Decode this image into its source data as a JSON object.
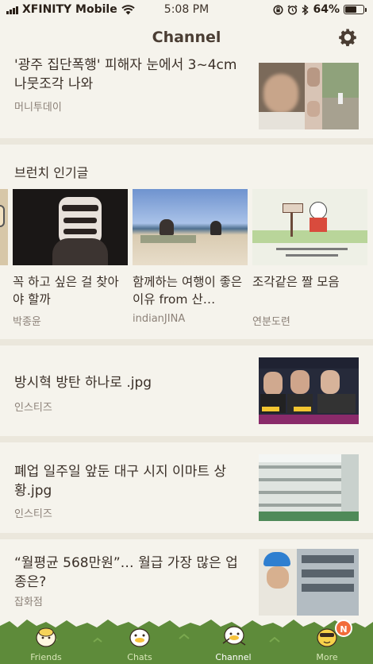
{
  "status": {
    "carrier": "XFINITY Mobile",
    "time": "5:08 PM",
    "battery_percent": "64%",
    "battery_level": 0.64
  },
  "nav": {
    "title": "Channel"
  },
  "articles_top": [
    {
      "headline": "'광주 집단폭행' 피해자 눈에서 3~4cm 나뭇조각 나와",
      "source": "머니투데이"
    }
  ],
  "brunch": {
    "section_title": "브런치 인기글",
    "cards": [
      {
        "title": "꼭 하고 싶은 걸 찾아야 할까",
        "author": "박종윤"
      },
      {
        "title": "함께하는 여행이 좋은 이유 from 산…",
        "author": "indianJINA"
      },
      {
        "title": "조각같은 짤 모음",
        "author": "연분도련"
      }
    ]
  },
  "articles": [
    {
      "headline": "방시혁 방탄 하나로 .jpg",
      "source": "인스티즈"
    },
    {
      "headline": "폐업 일주일 앞둔 대구 시지 이마트 상황.jpg",
      "source": "인스티즈"
    },
    {
      "headline": "“월평균 568만원”… 월급 가장 많은 업종은?",
      "source": "잡화점"
    }
  ],
  "tabs": [
    {
      "label": "Friends"
    },
    {
      "label": "Chats"
    },
    {
      "label": "Channel"
    },
    {
      "label": "More",
      "badge": "N"
    }
  ],
  "colors": {
    "background": "#f5f3ec",
    "tabbar_green": "#5e8b3a",
    "badge": "#f26b3a"
  }
}
